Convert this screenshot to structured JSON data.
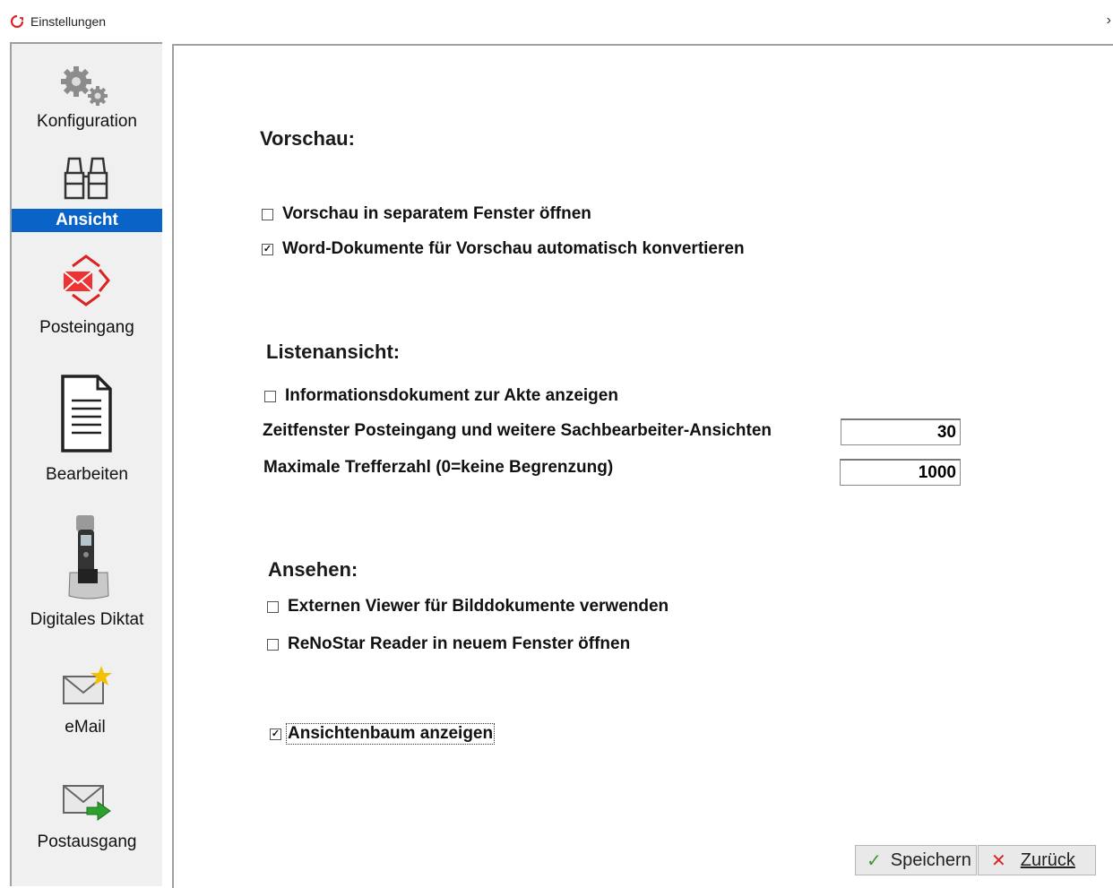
{
  "window": {
    "title": "Einstellungen",
    "close_glyph": "›"
  },
  "sidebar": {
    "items": [
      {
        "label": "Konfiguration",
        "icon": "gears-icon",
        "active": false
      },
      {
        "label": "Ansicht",
        "icon": "binoculars-icon",
        "active": true
      },
      {
        "label": "Posteingang",
        "icon": "inbox-mail-icon",
        "active": false
      },
      {
        "label": "Bearbeiten",
        "icon": "document-icon",
        "active": false
      },
      {
        "label": "Digitales Diktat",
        "icon": "dictation-device-icon",
        "active": false
      },
      {
        "label": "eMail",
        "icon": "new-mail-icon",
        "active": false
      },
      {
        "label": "Postausgang",
        "icon": "outgoing-mail-icon",
        "active": false
      }
    ],
    "active_color": "#0a64c8"
  },
  "sections": {
    "vorschau": {
      "title": "Vorschau:",
      "options": [
        {
          "label": "Vorschau in separatem Fenster öffnen",
          "checked": false
        },
        {
          "label": "Word-Dokumente für Vorschau automatisch konvertieren",
          "checked": true
        }
      ]
    },
    "listenansicht": {
      "title": "Listenansicht:",
      "options": [
        {
          "label": "Informationsdokument zur Akte anzeigen",
          "checked": false
        }
      ],
      "fields": [
        {
          "label": "Zeitfenster Posteingang und weitere Sachbearbeiter-Ansichten",
          "value": "30"
        },
        {
          "label": "Maximale Trefferzahl (0=keine Begrenzung)",
          "value": "1000"
        }
      ]
    },
    "ansehen": {
      "title": "Ansehen:",
      "options": [
        {
          "label": "Externen Viewer für Bilddokumente verwenden",
          "checked": false
        },
        {
          "label": "ReNoStar Reader in neuem Fenster öffnen",
          "checked": false
        }
      ]
    },
    "ansichtenbaum": {
      "label": "Ansichtenbaum anzeigen",
      "checked": true
    }
  },
  "buttons": {
    "save": {
      "label": "Speichern",
      "icon": "checkmark-icon"
    },
    "back": {
      "label": "Zurück",
      "icon": "x-icon"
    }
  },
  "check_glyph": "✓"
}
